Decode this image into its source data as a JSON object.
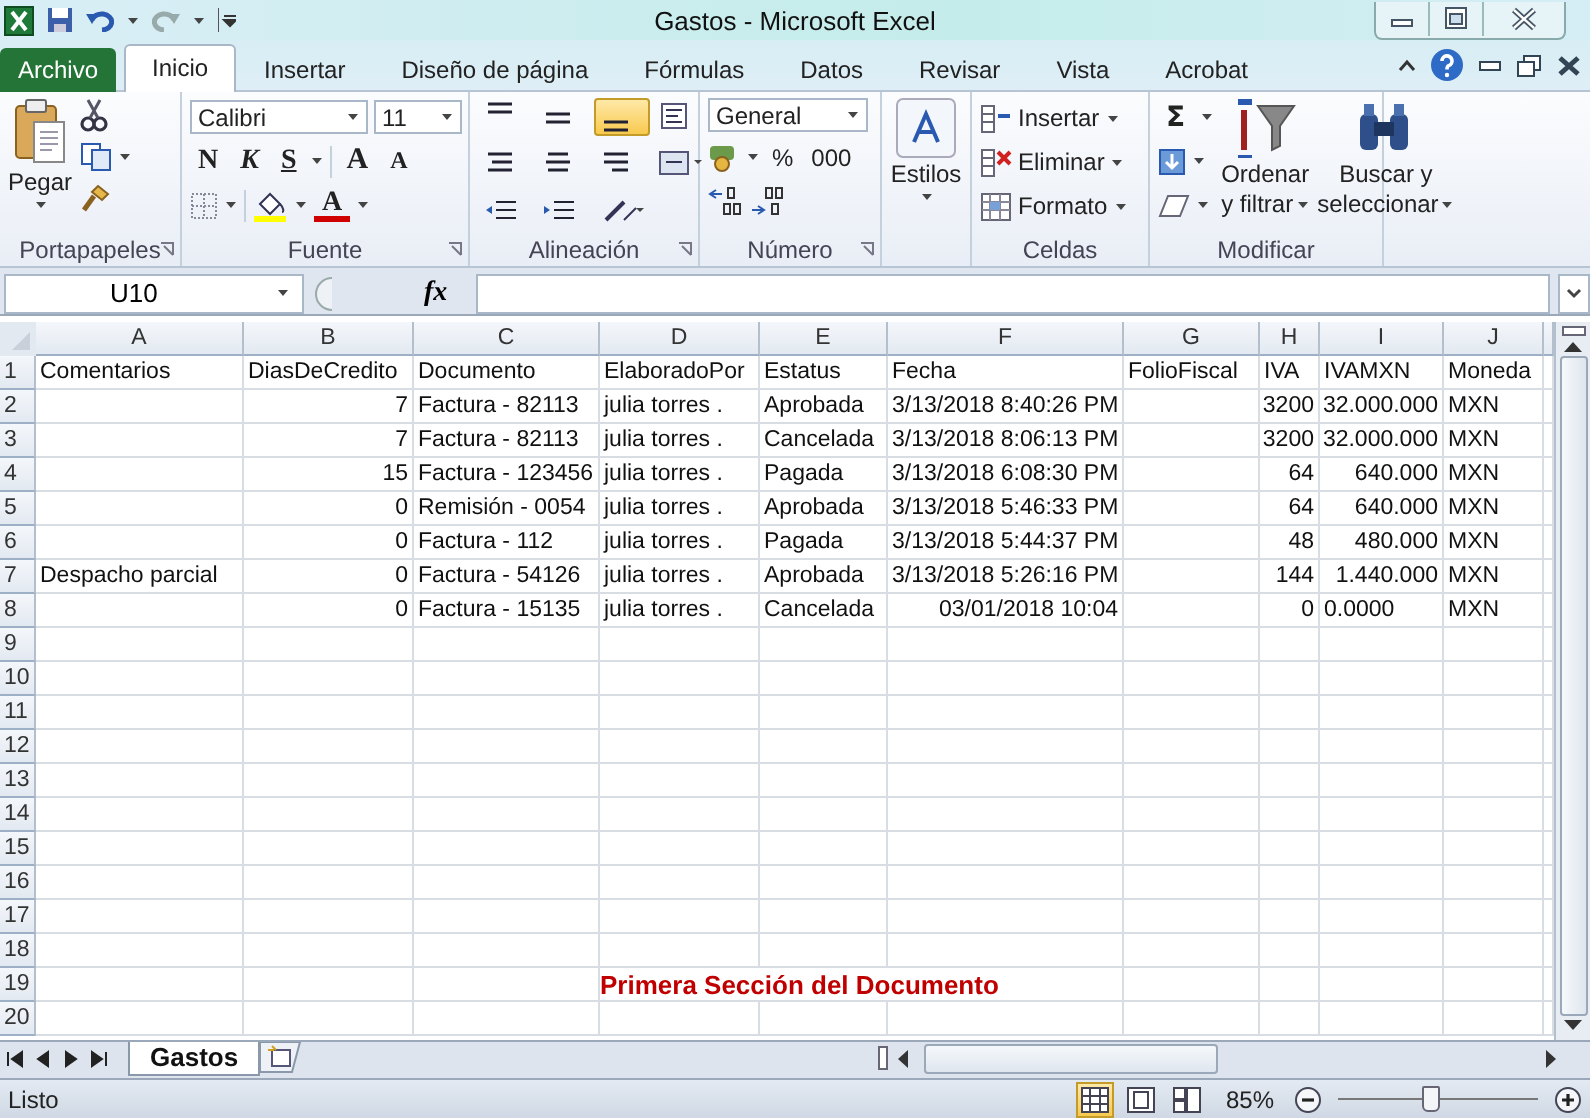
{
  "window": {
    "title": "Gastos - Microsoft Excel"
  },
  "tabs": [
    {
      "label": "Archivo",
      "kind": "file",
      "selected": false
    },
    {
      "label": "Inicio",
      "kind": "tab",
      "selected": true
    },
    {
      "label": "Insertar",
      "kind": "tab",
      "selected": false
    },
    {
      "label": "Diseño de página",
      "kind": "tab",
      "selected": false
    },
    {
      "label": "Fórmulas",
      "kind": "tab",
      "selected": false
    },
    {
      "label": "Datos",
      "kind": "tab",
      "selected": false
    },
    {
      "label": "Revisar",
      "kind": "tab",
      "selected": false
    },
    {
      "label": "Vista",
      "kind": "tab",
      "selected": false
    },
    {
      "label": "Acrobat",
      "kind": "tab",
      "selected": false
    }
  ],
  "ribbon": {
    "groups": [
      {
        "kind": "clipboard",
        "label": "Portapapeles",
        "paste": "Pegar"
      },
      {
        "kind": "font",
        "label": "Fuente",
        "font_name": "Calibri",
        "font_size": "11",
        "styles": [
          "N",
          "K",
          "S"
        ],
        "grow": "A",
        "shrink": "A",
        "font_color": "A"
      },
      {
        "kind": "alignment",
        "label": "Alineación",
        "align_buttons": [
          {
            "selected": false
          },
          {
            "selected": false
          },
          {
            "selected": true
          },
          {
            "selected": false
          },
          {
            "selected": false
          },
          {
            "selected": false
          }
        ]
      },
      {
        "kind": "number",
        "label": "Número",
        "format": "General",
        "symbols": [
          "%",
          "000"
        ]
      },
      {
        "kind": "styles",
        "button": "Estilos"
      },
      {
        "kind": "cells",
        "label": "Celdas",
        "buttons": [
          "Insertar",
          "Eliminar",
          "Formato"
        ]
      },
      {
        "kind": "editing",
        "label": "Modificar",
        "sum": "Σ",
        "buttons": [
          [
            "Ordenar",
            "y filtrar"
          ],
          [
            "Buscar y",
            "seleccionar"
          ]
        ]
      }
    ]
  },
  "formula_bar": {
    "name_box": "U10",
    "fx": "fx"
  },
  "sheet": {
    "columns": [
      "A",
      "B",
      "C",
      "D",
      "E",
      "F",
      "G",
      "H",
      "I",
      "J"
    ],
    "rows": [
      {
        "number": "1",
        "cells": [
          {
            "text": "Comentarios",
            "kind": "text"
          },
          {
            "text": "DiasDeCredito",
            "kind": "text"
          },
          {
            "text": "Documento",
            "kind": "text"
          },
          {
            "text": "ElaboradoPor",
            "kind": "text"
          },
          {
            "text": "Estatus",
            "kind": "text"
          },
          {
            "text": "Fecha",
            "kind": "text"
          },
          {
            "text": "FolioFiscal",
            "kind": "text"
          },
          {
            "text": "IVA",
            "kind": "text"
          },
          {
            "text": "IVAMXN",
            "kind": "text"
          },
          {
            "text": "Moneda",
            "kind": "text"
          }
        ]
      },
      {
        "number": "2",
        "cells": [
          {
            "kind": "blank"
          },
          {
            "text": "7",
            "kind": "number"
          },
          {
            "text": "Factura - 82113",
            "kind": "text"
          },
          {
            "text": "julia torres .",
            "kind": "text"
          },
          {
            "text": "Aprobada",
            "kind": "text"
          },
          {
            "text": "3/13/2018 8:40:26 PM",
            "kind": "text"
          },
          {
            "kind": "blank"
          },
          {
            "text": "3200",
            "kind": "number"
          },
          {
            "text": "32.000.000",
            "kind": "number"
          },
          {
            "text": "MXN",
            "kind": "text"
          }
        ]
      },
      {
        "number": "3",
        "cells": [
          {
            "kind": "blank"
          },
          {
            "text": "7",
            "kind": "number"
          },
          {
            "text": "Factura - 82113",
            "kind": "text"
          },
          {
            "text": "julia torres .",
            "kind": "text"
          },
          {
            "text": "Cancelada",
            "kind": "text"
          },
          {
            "text": "3/13/2018 8:06:13 PM",
            "kind": "text"
          },
          {
            "kind": "blank"
          },
          {
            "text": "3200",
            "kind": "number"
          },
          {
            "text": "32.000.000",
            "kind": "number"
          },
          {
            "text": "MXN",
            "kind": "text"
          }
        ]
      },
      {
        "number": "4",
        "cells": [
          {
            "kind": "blank"
          },
          {
            "text": "15",
            "kind": "number"
          },
          {
            "text": "Factura - 123456",
            "kind": "text"
          },
          {
            "text": "julia torres .",
            "kind": "text"
          },
          {
            "text": "Pagada",
            "kind": "text"
          },
          {
            "text": "3/13/2018 6:08:30 PM",
            "kind": "text"
          },
          {
            "kind": "blank"
          },
          {
            "text": "64",
            "kind": "number"
          },
          {
            "text": "640.000",
            "kind": "number"
          },
          {
            "text": "MXN",
            "kind": "text"
          }
        ]
      },
      {
        "number": "5",
        "cells": [
          {
            "kind": "blank"
          },
          {
            "text": "0",
            "kind": "number"
          },
          {
            "text": "Remisión - 0054",
            "kind": "text"
          },
          {
            "text": "julia torres .",
            "kind": "text"
          },
          {
            "text": "Aprobada",
            "kind": "text"
          },
          {
            "text": "3/13/2018 5:46:33 PM",
            "kind": "text"
          },
          {
            "kind": "blank"
          },
          {
            "text": "64",
            "kind": "number"
          },
          {
            "text": "640.000",
            "kind": "number"
          },
          {
            "text": "MXN",
            "kind": "text"
          }
        ]
      },
      {
        "number": "6",
        "cells": [
          {
            "kind": "blank"
          },
          {
            "text": "0",
            "kind": "number"
          },
          {
            "text": "Factura - 112",
            "kind": "text"
          },
          {
            "text": "julia torres .",
            "kind": "text"
          },
          {
            "text": "Pagada",
            "kind": "text"
          },
          {
            "text": "3/13/2018 5:44:37 PM",
            "kind": "text"
          },
          {
            "kind": "blank"
          },
          {
            "text": "48",
            "kind": "number"
          },
          {
            "text": "480.000",
            "kind": "number"
          },
          {
            "text": "MXN",
            "kind": "text"
          }
        ]
      },
      {
        "number": "7",
        "cells": [
          {
            "text": "Despacho parcial",
            "kind": "text"
          },
          {
            "text": "0",
            "kind": "number"
          },
          {
            "text": "Factura - 54126",
            "kind": "text"
          },
          {
            "text": "julia torres .",
            "kind": "text"
          },
          {
            "text": "Aprobada",
            "kind": "text"
          },
          {
            "text": "3/13/2018 5:26:16 PM",
            "kind": "text"
          },
          {
            "kind": "blank"
          },
          {
            "text": "144",
            "kind": "number"
          },
          {
            "text": "1.440.000",
            "kind": "number"
          },
          {
            "text": "MXN",
            "kind": "text"
          }
        ]
      },
      {
        "number": "8",
        "cells": [
          {
            "kind": "blank"
          },
          {
            "text": "0",
            "kind": "number"
          },
          {
            "text": "Factura - 15135",
            "kind": "text"
          },
          {
            "text": "julia torres .",
            "kind": "text"
          },
          {
            "text": "Cancelada",
            "kind": "text"
          },
          {
            "text": "03/01/2018 10:04",
            "kind": "number"
          },
          {
            "kind": "blank"
          },
          {
            "text": "0",
            "kind": "number"
          },
          {
            "text": "0.0000",
            "kind": "text"
          },
          {
            "text": "MXN",
            "kind": "text"
          }
        ]
      },
      {
        "number": "9",
        "cells": []
      },
      {
        "number": "10",
        "cells": []
      },
      {
        "number": "11",
        "cells": []
      },
      {
        "number": "12",
        "cells": []
      },
      {
        "number": "13",
        "cells": []
      },
      {
        "number": "14",
        "cells": []
      },
      {
        "number": "15",
        "cells": []
      },
      {
        "number": "16",
        "cells": []
      },
      {
        "number": "17",
        "cells": []
      },
      {
        "number": "18",
        "cells": []
      },
      {
        "number": "19",
        "cells": [
          {
            "kind": "blank"
          },
          {
            "kind": "blank"
          },
          {
            "kind": "blank"
          },
          {
            "text": "Primera Sección del Documento",
            "kind": "banner"
          }
        ]
      },
      {
        "number": "20",
        "cells": []
      }
    ]
  },
  "sheet_tabs": [
    {
      "label": "Gastos",
      "selected": true
    }
  ],
  "status_bar": {
    "status": "Listo",
    "views": [
      {
        "selected": true
      },
      {
        "selected": false
      },
      {
        "selected": false
      }
    ],
    "zoom": "85%",
    "zoom_slider": {
      "level": 0.46
    }
  }
}
